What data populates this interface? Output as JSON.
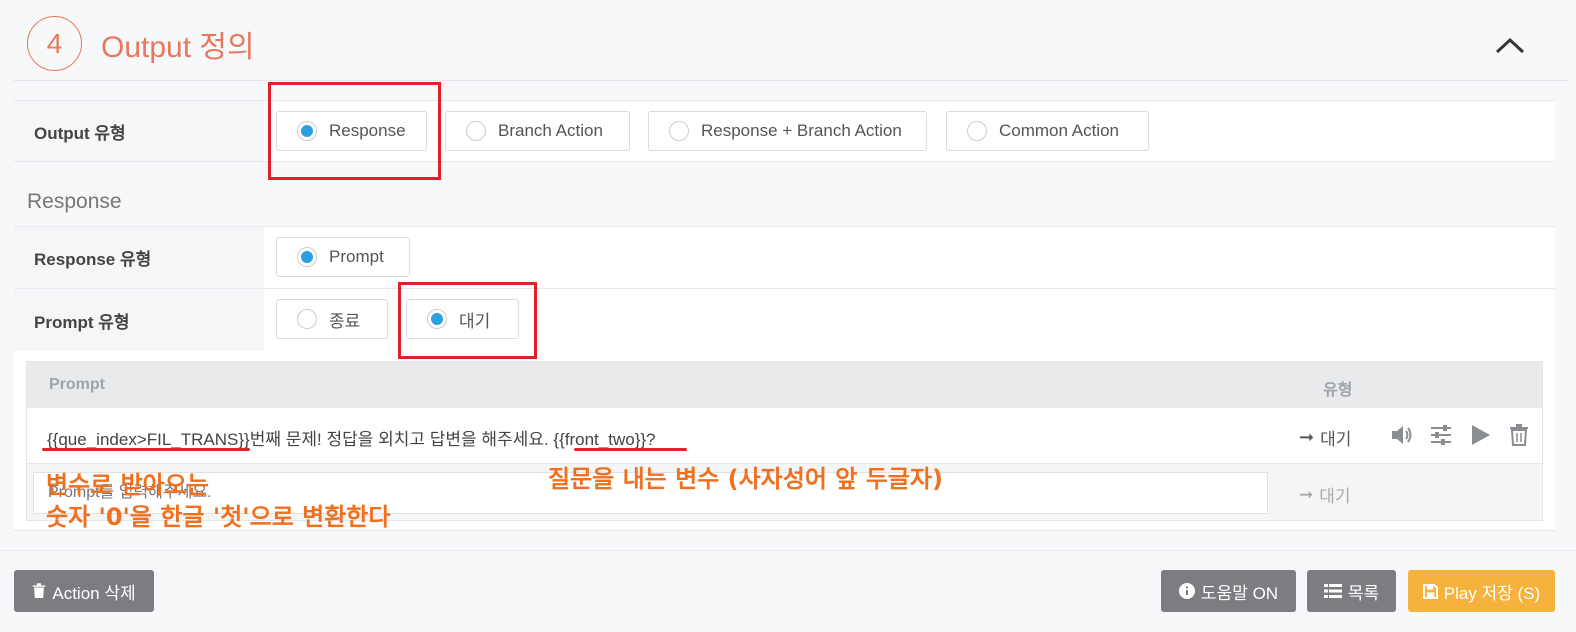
{
  "header": {
    "step": "4",
    "title": "Output 정의"
  },
  "output_type": {
    "label": "Output 유형",
    "options": [
      {
        "label": "Response",
        "checked": true
      },
      {
        "label": "Branch Action",
        "checked": false
      },
      {
        "label": "Response + Branch Action",
        "checked": false
      },
      {
        "label": "Common Action",
        "checked": false
      }
    ]
  },
  "response": {
    "section_title": "Response",
    "response_type": {
      "label": "Response 유형",
      "option": "Prompt"
    },
    "prompt_type": {
      "label": "Prompt 유형",
      "options": [
        {
          "label": "종료",
          "checked": false
        },
        {
          "label": "대기",
          "checked": true
        }
      ]
    }
  },
  "prompt_table": {
    "col_prompt": "Prompt",
    "col_type": "유형",
    "rows": [
      {
        "var1": "{{que_index>FIL_TRANS}}",
        "mid": "번째 문제! 정답을 외치고 답변을 해주세요. ",
        "var2": "{{front_two}}",
        "end": "?",
        "type": "대기"
      }
    ],
    "new_placeholder": "Prompt를 입력해주세요.",
    "new_type": "대기"
  },
  "annotations": {
    "left_line1": "변수로 받아오는",
    "left_line2": "숫자 '0'을 한글 '첫'으로 변환한다",
    "right": "질문을 내는 변수 (사자성어 앞 두글자)"
  },
  "footer": {
    "delete_label": "Action 삭제",
    "help_label": "도움말 ON",
    "list_label": "목록",
    "save_label": "Play 저장 (S)"
  },
  "colors": {
    "accent": "#e8785c",
    "radio_checked": "#2b9fe0",
    "highlight": "#e0212b",
    "annotation": "#f07020",
    "save_button": "#f5b23c",
    "gray_button": "#7b7d80"
  }
}
